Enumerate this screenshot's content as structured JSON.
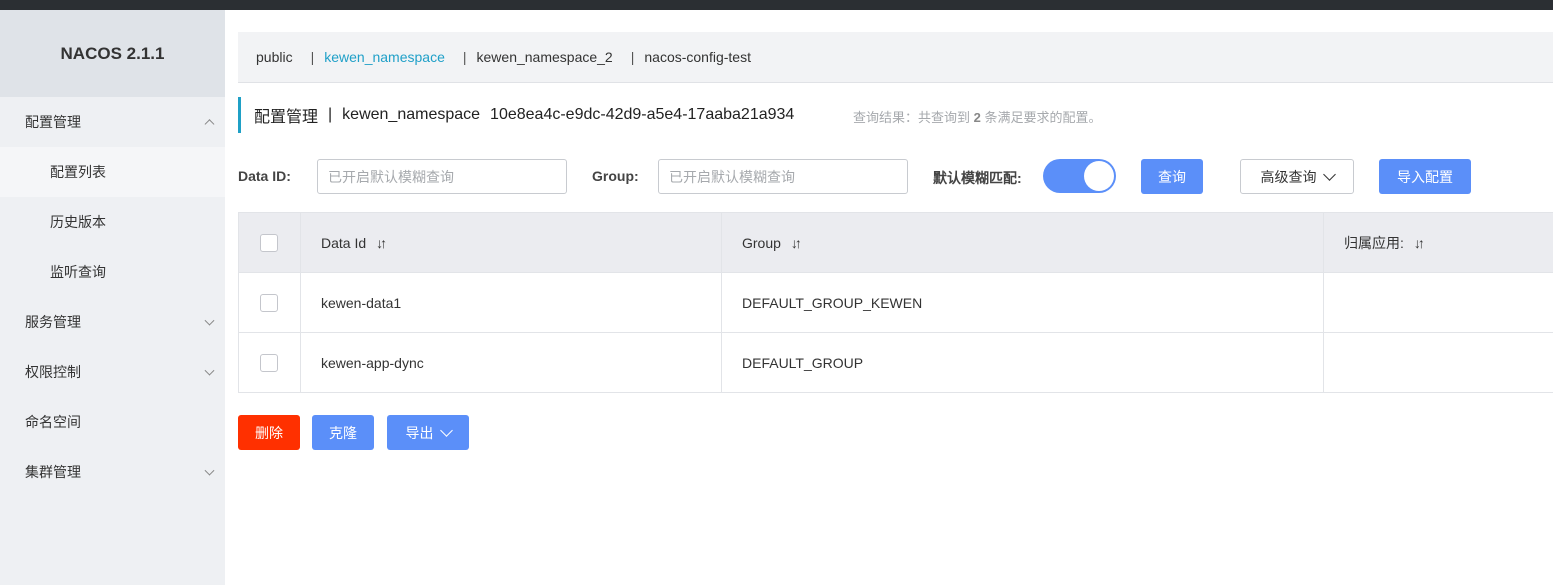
{
  "app": {
    "brand": "NACOS 2.1.1"
  },
  "sidebar": {
    "items": [
      {
        "label": "配置管理"
      },
      {
        "label": "配置列表"
      },
      {
        "label": "历史版本"
      },
      {
        "label": "监听查询"
      },
      {
        "label": "服务管理"
      },
      {
        "label": "权限控制"
      },
      {
        "label": "命名空间"
      },
      {
        "label": "集群管理"
      }
    ]
  },
  "namespaces": [
    {
      "label": "public"
    },
    {
      "label": "kewen_namespace"
    },
    {
      "label": "kewen_namespace_2"
    },
    {
      "label": "nacos-config-test"
    }
  ],
  "ns_separator": "|",
  "title": {
    "section": "配置管理",
    "separator": "|",
    "namespace": "kewen_namespace",
    "namespace_id": "10e8ea4c-e9dc-42d9-a5e4-17aaba21a934"
  },
  "query_result": {
    "prefix": "查询结果：共查询到 ",
    "count": "2",
    "suffix": " 条满足要求的配置。"
  },
  "filters": {
    "data_id_label": "Data ID:",
    "data_id_placeholder": "已开启默认模糊查询",
    "group_label": "Group:",
    "group_placeholder": "已开启默认模糊查询",
    "fuzzy_label": "默认模糊匹配:",
    "fuzzy_on": true
  },
  "buttons": {
    "query": "查询",
    "advanced": "高级查询",
    "import": "导入配置",
    "delete": "删除",
    "clone": "克隆",
    "export": "导出"
  },
  "table": {
    "columns": [
      "Data Id",
      "Group",
      "归属应用:"
    ],
    "sort_glyph": "↓↑",
    "rows": [
      {
        "data_id": "kewen-data1",
        "group": "DEFAULT_GROUP_KEWEN",
        "app": ""
      },
      {
        "data_id": "kewen-app-dync",
        "group": "DEFAULT_GROUP",
        "app": ""
      }
    ]
  },
  "colors": {
    "accent": "#5b8ff9",
    "namespace_active": "#20a0c8",
    "danger": "#ff3000",
    "sidebar_bg": "#eef0f3"
  }
}
